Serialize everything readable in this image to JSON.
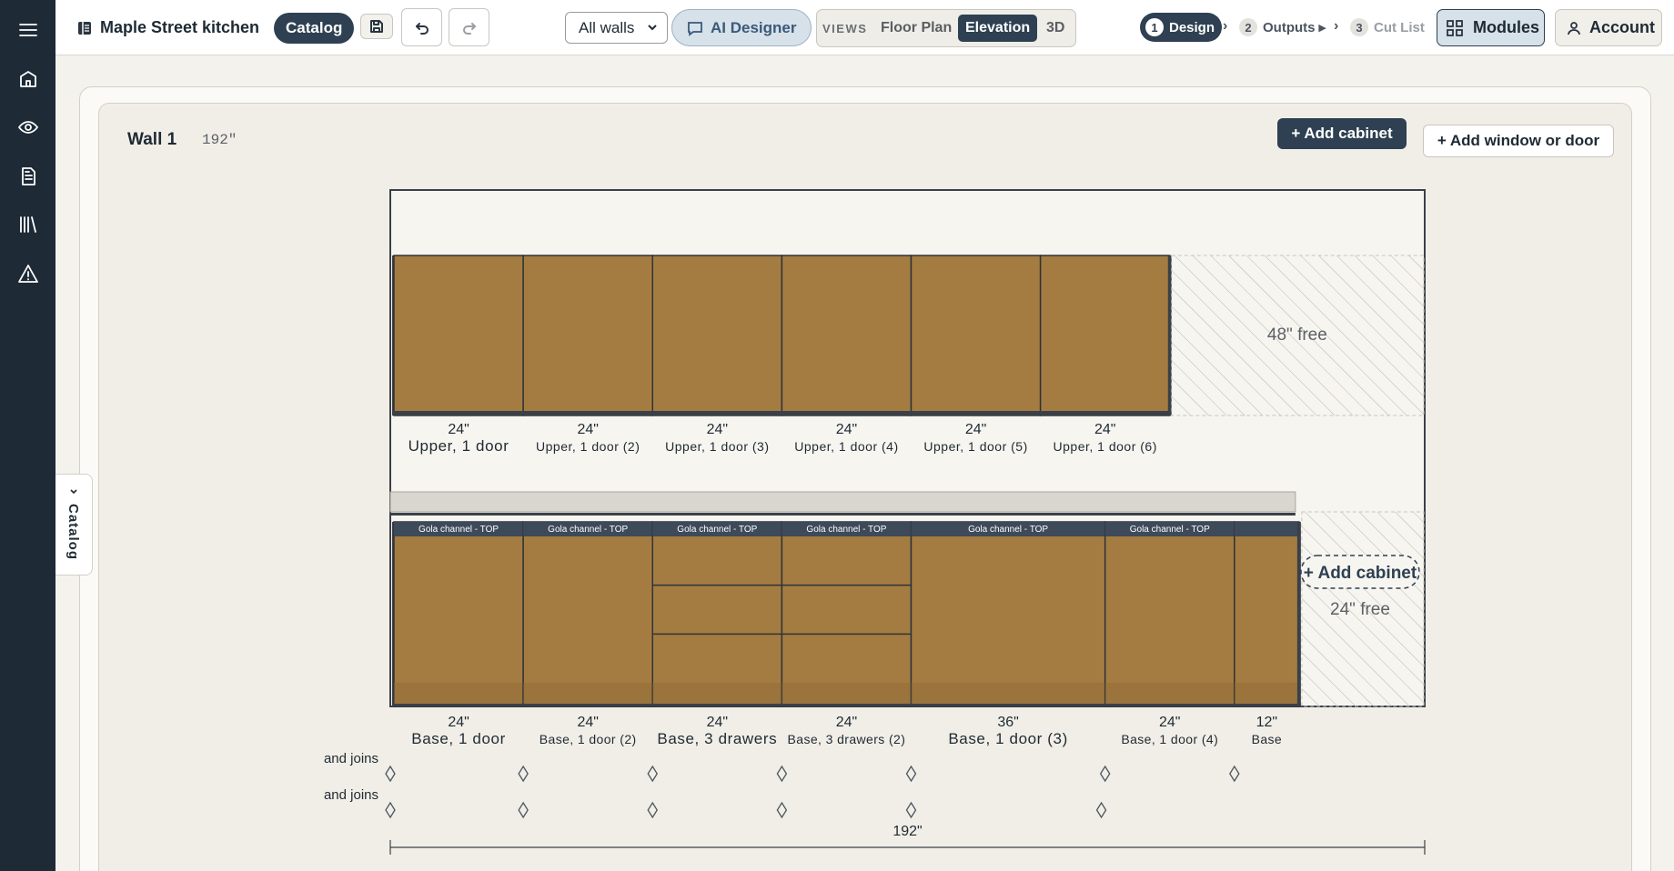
{
  "app": {
    "project_name": "Maple Street kitchen",
    "catalog_label": "Catalog",
    "wall_select": "All walls",
    "ai_label": "AI Designer",
    "views": {
      "label": "VIEWS",
      "tabs": [
        "Floor Plan",
        "Elevation",
        "3D"
      ],
      "active": "Elevation"
    },
    "steps": [
      {
        "num": "1",
        "label": "Design",
        "state": "active"
      },
      {
        "num": "2",
        "label": "Outputs ▸",
        "state": "normal"
      },
      {
        "num": "3",
        "label": "Cut List",
        "state": "dim"
      }
    ],
    "modules_label": "Modules",
    "account_label": "Account",
    "side_catalog": "Catalog"
  },
  "rail_icons": [
    "menu-icon",
    "home-icon",
    "eye-icon",
    "document-icon",
    "library-icon",
    "warning-icon"
  ],
  "wall": {
    "title": "Wall 1",
    "length": "192\"",
    "add_cabinet": "+ Add cabinet",
    "add_window": "+ Add window or door",
    "upper_cabinets": [
      {
        "width": "24\"",
        "name": "Upper, 1 door"
      },
      {
        "width": "24\"",
        "name": "Upper, 1 door (2)"
      },
      {
        "width": "24\"",
        "name": "Upper, 1 door (3)"
      },
      {
        "width": "24\"",
        "name": "Upper, 1 door (4)"
      },
      {
        "width": "24\"",
        "name": "Upper, 1 door (5)"
      },
      {
        "width": "24\"",
        "name": "Upper, 1 door (6)"
      }
    ],
    "upper_free": "48\" free",
    "base_cabinets": [
      {
        "width": "24\"",
        "name": "Base, 1 door",
        "channel": "Gola channel - TOP",
        "drawers": 0
      },
      {
        "width": "24\"",
        "name": "Base, 1 door (2)",
        "channel": "Gola channel - TOP",
        "drawers": 0
      },
      {
        "width": "24\"",
        "name": "Base, 3 drawers",
        "channel": "Gola channel - TOP",
        "drawers": 3
      },
      {
        "width": "24\"",
        "name": "Base, 3 drawers (2)",
        "channel": "Gola channel - TOP",
        "drawers": 3
      },
      {
        "width": "36\"",
        "name": "Base, 1 door (3)",
        "channel": "Gola channel - TOP",
        "drawers": 0
      },
      {
        "width": "24\"",
        "name": "Base, 1 door (4)",
        "channel": "Gola channel - TOP",
        "drawers": 0
      },
      {
        "width": "12\"",
        "name": "Base",
        "channel": "",
        "drawers": 0
      }
    ],
    "base_free": "24\" free",
    "base_add": "+ Add cabinet",
    "joins_label": "and joins",
    "total_dim": "192\"",
    "colors": {
      "cabinet": "#a47c42",
      "frame": "#3a4048",
      "channel": "#3d4a5a"
    }
  }
}
